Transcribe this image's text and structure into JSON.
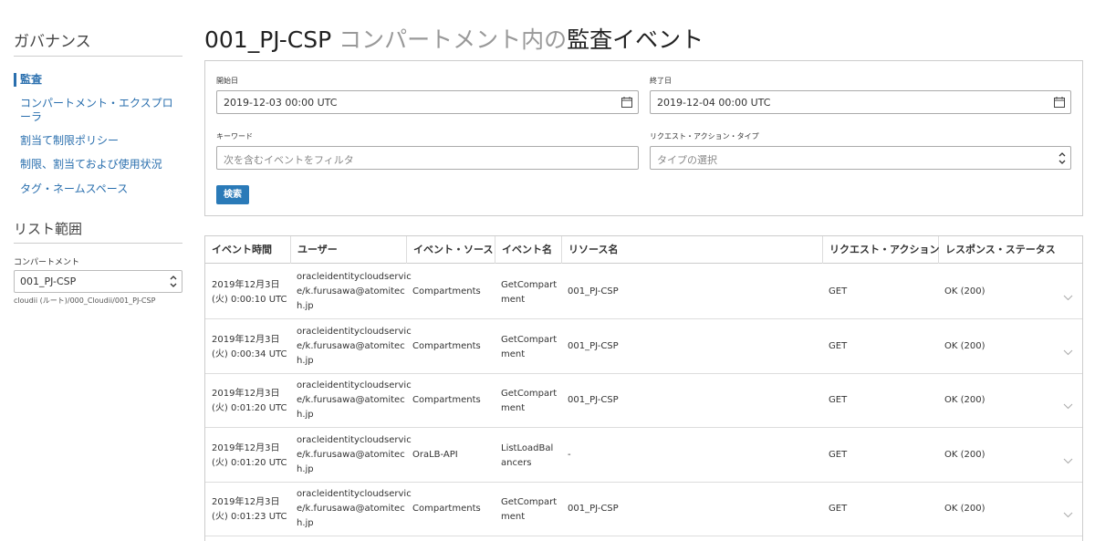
{
  "sidebar": {
    "title": "ガバナンス",
    "nav": [
      {
        "label": "監査",
        "active": true
      },
      {
        "label": "コンパートメント・エクスプローラ"
      },
      {
        "label": "割当て制限ポリシー"
      },
      {
        "label": "制限、割当ておよび使用状況"
      },
      {
        "label": "タグ・ネームスペース"
      }
    ],
    "scope_title": "リスト範囲",
    "compartment_label": "コンパートメント",
    "compartment_value": "001_PJ-CSP",
    "compartment_path": "cloudii (ルート)/000_Cloudii/001_PJ-CSP"
  },
  "header": {
    "title_a": "001_PJ-CSP ",
    "title_b": "コンパートメント内の",
    "title_c": "監査イベント"
  },
  "filters": {
    "start_label": "開始日",
    "start_value": "2019-12-03 00:00 UTC",
    "end_label": "終了日",
    "end_value": "2019-12-04 00:00 UTC",
    "keyword_label": "キーワード",
    "keyword_placeholder": "次を含むイベントをフィルタ",
    "type_label": "リクエスト・アクション・タイプ",
    "type_placeholder": "タイプの選択",
    "search_label": "検索"
  },
  "table": {
    "columns": [
      "イベント時間",
      "ユーザー",
      "イベント・ソース",
      "イベント名",
      "リソース名",
      "リクエスト・アクション",
      "レスポンス・ステータス"
    ],
    "rows": [
      {
        "time1": "2019年12月3日",
        "time2": "(火) 0:00:10 UTC",
        "user1": "oracleidentitycloudservic",
        "user2": "e/k.furusawa@atomitec",
        "user3": "h.jp",
        "source": "Compartments",
        "name1": "GetCompart",
        "name2": "ment",
        "resource": "001_PJ-CSP",
        "action": "GET",
        "status": "OK (200)"
      },
      {
        "time1": "2019年12月3日",
        "time2": "(火) 0:00:34 UTC",
        "user1": "oracleidentitycloudservic",
        "user2": "e/k.furusawa@atomitec",
        "user3": "h.jp",
        "source": "Compartments",
        "name1": "GetCompart",
        "name2": "ment",
        "resource": "001_PJ-CSP",
        "action": "GET",
        "status": "OK (200)"
      },
      {
        "time1": "2019年12月3日",
        "time2": "(火) 0:01:20 UTC",
        "user1": "oracleidentitycloudservic",
        "user2": "e/k.furusawa@atomitec",
        "user3": "h.jp",
        "source": "Compartments",
        "name1": "GetCompart",
        "name2": "ment",
        "resource": "001_PJ-CSP",
        "action": "GET",
        "status": "OK (200)"
      },
      {
        "time1": "2019年12月3日",
        "time2": "(火) 0:01:20 UTC",
        "user1": "oracleidentitycloudservic",
        "user2": "e/k.furusawa@atomitec",
        "user3": "h.jp",
        "source": "OraLB-API",
        "name1": "ListLoadBal",
        "name2": "ancers",
        "resource": "-",
        "action": "GET",
        "status": "OK (200)"
      },
      {
        "time1": "2019年12月3日",
        "time2": "(火) 0:01:23 UTC",
        "user1": "oracleidentitycloudservic",
        "user2": "e/k.furusawa@atomitec",
        "user3": "h.jp",
        "source": "Compartments",
        "name1": "GetCompart",
        "name2": "ment",
        "resource": "001_PJ-CSP",
        "action": "GET",
        "status": "OK (200)"
      }
    ]
  }
}
